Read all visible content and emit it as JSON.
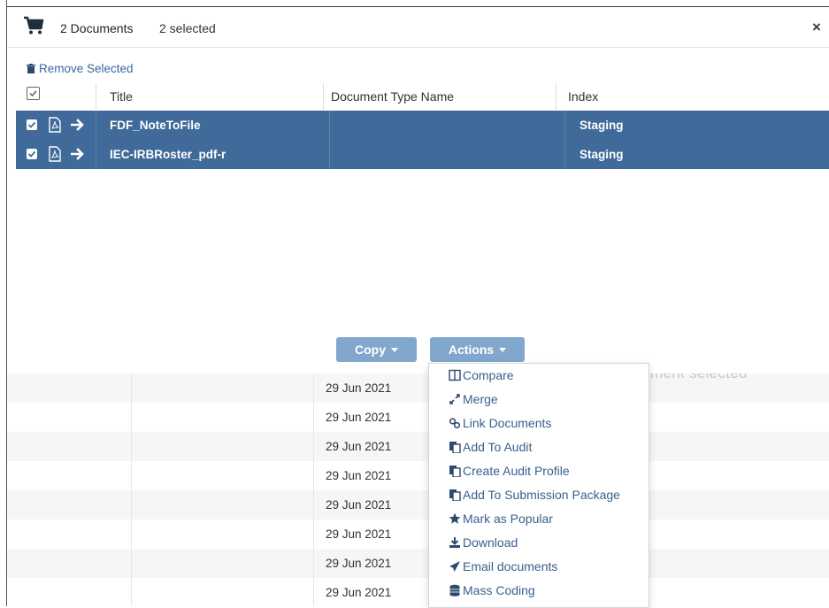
{
  "background": {
    "status_text": "ment selected",
    "dates": [
      "29 Jun 2021",
      "29 Jun 2021",
      "29 Jun 2021",
      "29 Jun 2021",
      "29 Jun 2021",
      "29 Jun 2021",
      "29 Jun 2021",
      "29 Jun 2021"
    ]
  },
  "cart": {
    "icon": "shopping-cart-icon",
    "doc_count": "2 Documents",
    "selected_count": "2 selected",
    "close_label": "×",
    "remove_selected": "Remove Selected",
    "columns": {
      "title": "Title",
      "doc_type": "Document Type Name",
      "index": "Index"
    },
    "rows": [
      {
        "title": "FDF_NoteToFile",
        "doc_type": "",
        "index": "Staging",
        "checked": true
      },
      {
        "title": "IEC-IRBRoster_pdf-r",
        "doc_type": "",
        "index": "Staging",
        "checked": true
      }
    ],
    "copy_label": "Copy",
    "actions_label": "Actions"
  },
  "actions_menu": {
    "items": [
      {
        "label": "Compare",
        "icon": "columns-icon"
      },
      {
        "label": "Merge",
        "icon": "merge-icon"
      },
      {
        "label": "Link Documents",
        "icon": "link-icon"
      },
      {
        "label": "Add To Audit",
        "icon": "copy-icon"
      },
      {
        "label": "Create Audit Profile",
        "icon": "copy-icon"
      },
      {
        "label": "Add To Submission Package",
        "icon": "copy-icon"
      },
      {
        "label": "Mark as Popular",
        "icon": "star-icon"
      },
      {
        "label": "Download",
        "icon": "download-icon"
      },
      {
        "label": "Email documents",
        "icon": "send-icon"
      },
      {
        "label": "Mass Coding",
        "icon": "database-icon"
      }
    ]
  },
  "colors": {
    "selected_row": "#3f6a99",
    "button": "#82a7cc",
    "link": "#3a6090"
  }
}
